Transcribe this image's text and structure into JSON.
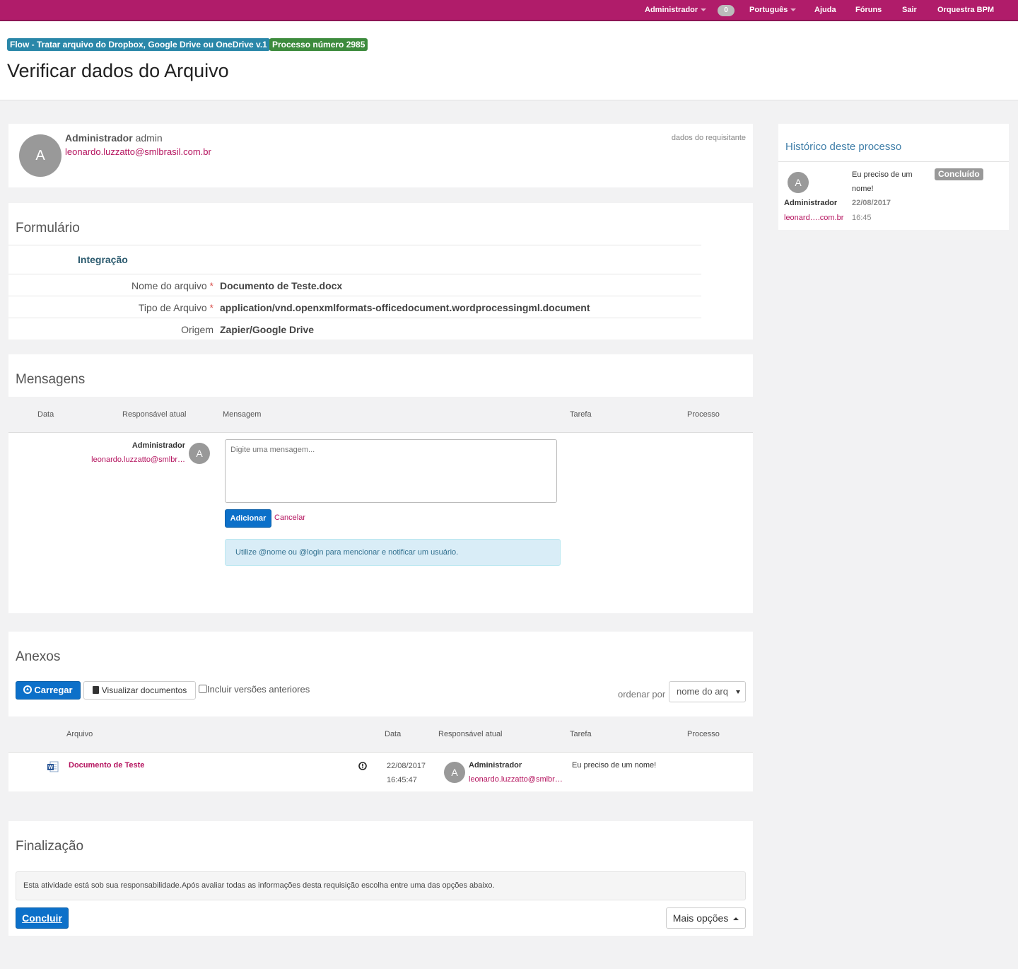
{
  "nav": {
    "user": "Administrador",
    "notifications": "0",
    "language": "Português",
    "help": "Ajuda",
    "forums": "Fóruns",
    "logout": "Sair",
    "brand": "Orquestra BPM"
  },
  "header": {
    "flow_label": "Flow - Tratar arquivo do Dropbox, Google Drive ou OneDrive v.1",
    "process_label": "Processo número 2985",
    "title": "Verificar dados do Arquivo"
  },
  "requester": {
    "avatar": "A",
    "name": "Administrador",
    "login": "admin",
    "email": "leonardo.luzzatto@smlbrasil.com.br",
    "note": "dados do requisitante"
  },
  "form": {
    "title": "Formulário",
    "section": "Integração",
    "fields": [
      {
        "label": "Nome do arquivo",
        "required": "*",
        "value": "Documento de Teste.docx"
      },
      {
        "label": "Tipo de Arquivo",
        "required": "*",
        "value": "application/vnd.openxmlformats-officedocument.wordprocessingml.document"
      },
      {
        "label": "Origem",
        "required": "",
        "value": "Zapier/Google Drive"
      }
    ]
  },
  "messages": {
    "title": "Mensagens",
    "columns": [
      "Data",
      "Responsável atual",
      "Mensagem",
      "Tarefa",
      "Processo"
    ],
    "author_name": "Administrador",
    "author_email": "leonardo.luzzatto@smlbr…",
    "author_avatar": "A",
    "placeholder": "Digite uma mensagem...",
    "add_label": "Adicionar",
    "cancel_label": "Cancelar",
    "hint": "Utilize @nome ou @login para mencionar e notificar um usuário."
  },
  "attachments": {
    "title": "Anexos",
    "upload_label": "Carregar",
    "view_label": "Visualizar documentos",
    "include_versions": "Incluir versões anteriores",
    "sort_label": "ordenar por",
    "sort_value": "nome do arq",
    "columns": [
      "Arquivo",
      "Data",
      "Responsável atual",
      "Tarefa",
      "Processo"
    ],
    "rows": [
      {
        "file": "Documento de Teste",
        "date": "22/08/2017",
        "time": "16:45:47",
        "avatar": "A",
        "owner": "Administrador",
        "owner_email": "leonardo.luzzatto@smlbr…",
        "task": "Eu preciso de um nome!"
      }
    ]
  },
  "finalization": {
    "title": "Finalização",
    "note": "Esta atividade está sob sua responsabilidade.Após avaliar todas as informações desta requisição escolha entre uma das opções abaixo.",
    "conclude_label": "Concluir",
    "more_label": "Mais opções"
  },
  "history": {
    "title": "Histórico deste processo",
    "avatar": "A",
    "name": "Administrador",
    "email": "leonard….com.br",
    "task_line1": "Eu preciso de um",
    "task_line2": "nome!",
    "status": "Concluído",
    "date": "22/08/2017",
    "time": "16:45"
  },
  "colors": {
    "brand": "#b01c6a",
    "primary": "#0c70c9",
    "link": "#b5145f",
    "flow_label": "#2a87a9",
    "process_label": "#3d8b3d"
  },
  "icons": [
    "caret-down-icon",
    "upload-circle-icon",
    "book-icon",
    "word-file-icon",
    "info-circle-icon",
    "caret-up-icon"
  ]
}
